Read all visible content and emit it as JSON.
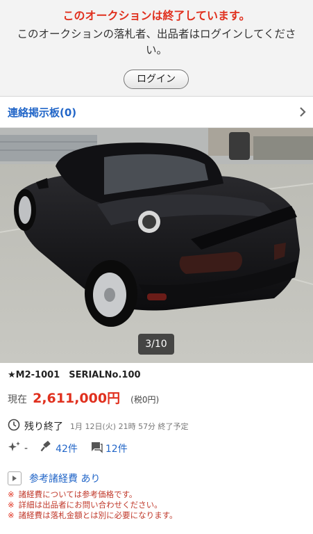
{
  "ended_notice": {
    "title": "このオークションは終了しています。",
    "message": "このオークションの落札者、出品者はログインしてください。",
    "login_button": "ログイン"
  },
  "message_board": {
    "label": "連絡掲示板(0)"
  },
  "photo": {
    "counter": "3/10"
  },
  "item": {
    "title": "★M2-1001　SERIALNo.100",
    "price_label": "現在",
    "price": "2,611,000円",
    "tax": "(税0円)"
  },
  "time": {
    "remaining_label": "残り終了",
    "end": "1月 12日(火) 21時 57分 終了予定"
  },
  "stats": {
    "featured": "-",
    "bids": "42件",
    "comments": "12件"
  },
  "fees": {
    "label": "参考諸経費 あり",
    "notes": [
      "諸経費については参考価格です。",
      "詳細は出品者にお問い合わせください。",
      "諸経費は落札金額とは別に必要になります。"
    ],
    "note_mark": "※"
  },
  "colors": {
    "alert_red": "#e0301e",
    "link_blue": "#2266c8",
    "banner_gray": "#f3f3f3"
  }
}
